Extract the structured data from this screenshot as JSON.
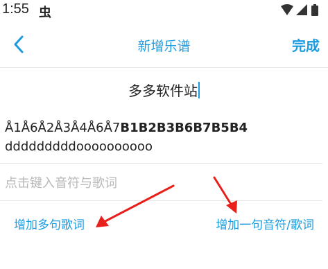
{
  "status_bar": {
    "time": "1:55",
    "app_icon": "虫",
    "icons": [
      "wifi-icon",
      "signal-icon",
      "battery-icon"
    ]
  },
  "header": {
    "title": "新增乐谱",
    "done_label": "完成",
    "back_icon": "chevron-left-icon"
  },
  "editor": {
    "title_value": "多多软件站",
    "score_notes_prefix": "Å1Å6Å2Å3Å4Å6Å7",
    "score_notes_bold": "B1B2B3B6B7B5B4",
    "lyrics": "dddddddddoooooooooo",
    "input_placeholder": "点击键入音符与歌词"
  },
  "actions": {
    "add_multi_label": "增加多句歌词",
    "add_single_label": "增加一句音符/歌词"
  },
  "colors": {
    "accent": "#1a9be0",
    "annotation_arrow": "#e8201c",
    "placeholder": "#b8b8b8"
  }
}
